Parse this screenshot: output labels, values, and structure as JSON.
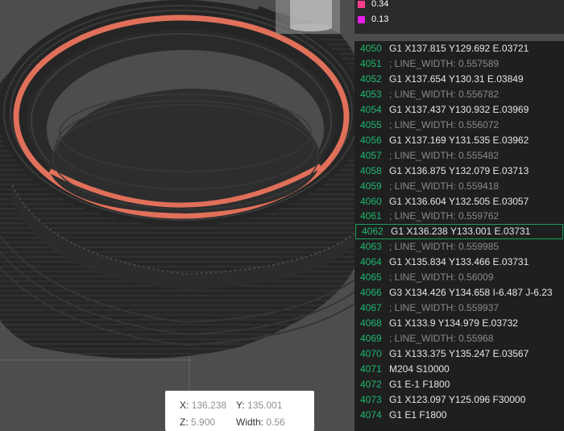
{
  "legend": {
    "items": [
      {
        "label": "0.34",
        "color": "#ff3d8b"
      },
      {
        "label": "0.13",
        "color": "#e61ee6"
      }
    ]
  },
  "gcode": {
    "lines": [
      {
        "num": "4050",
        "text": "G1 X137.815 Y129.692 E.03721",
        "comment": false
      },
      {
        "num": "4051",
        "text": "; LINE_WIDTH: 0.557589",
        "comment": true
      },
      {
        "num": "4052",
        "text": "G1 X137.654 Y130.31 E.03849",
        "comment": false
      },
      {
        "num": "4053",
        "text": "; LINE_WIDTH: 0.556782",
        "comment": true
      },
      {
        "num": "4054",
        "text": "G1 X137.437 Y130.932 E.03969",
        "comment": false
      },
      {
        "num": "4055",
        "text": "; LINE_WIDTH: 0.556072",
        "comment": true
      },
      {
        "num": "4056",
        "text": "G1 X137.169 Y131.535 E.03962",
        "comment": false
      },
      {
        "num": "4057",
        "text": "; LINE_WIDTH: 0.555482",
        "comment": true
      },
      {
        "num": "4058",
        "text": "G1 X136.875 Y132.079 E.03713",
        "comment": false
      },
      {
        "num": "4059",
        "text": "; LINE_WIDTH: 0.559418",
        "comment": true
      },
      {
        "num": "4060",
        "text": "G1 X136.604 Y132.505 E.03057",
        "comment": false
      },
      {
        "num": "4061",
        "text": "; LINE_WIDTH: 0.559762",
        "comment": true
      },
      {
        "num": "4062",
        "text": "G1 X136.238 Y133.001 E.03731",
        "comment": false,
        "selected": true
      },
      {
        "num": "4063",
        "text": "; LINE_WIDTH: 0.559985",
        "comment": true
      },
      {
        "num": "4064",
        "text": "G1 X135.834 Y133.466 E.03731",
        "comment": false
      },
      {
        "num": "4065",
        "text": "; LINE_WIDTH: 0.56009",
        "comment": true
      },
      {
        "num": "4066",
        "text": "G3 X134.426 Y134.658 I-6.487 J-6.23",
        "comment": false
      },
      {
        "num": "4067",
        "text": "; LINE_WIDTH: 0.559937",
        "comment": true
      },
      {
        "num": "4068",
        "text": "G1 X133.9 Y134.979 E.03732",
        "comment": false
      },
      {
        "num": "4069",
        "text": "; LINE_WIDTH: 0.55968",
        "comment": true
      },
      {
        "num": "4070",
        "text": "G1 X133.375 Y135.247 E.03567",
        "comment": false
      },
      {
        "num": "4071",
        "text": "M204 S10000",
        "comment": false
      },
      {
        "num": "4072",
        "text": "G1 E-1 F1800",
        "comment": false
      },
      {
        "num": "4073",
        "text": "G1 X123.097 Y125.096 F30000",
        "comment": false
      },
      {
        "num": "4074",
        "text": "G1 E1 F1800",
        "comment": false
      }
    ]
  },
  "tooltip": {
    "x_label": "X:",
    "x_value": "136.238",
    "y_label": "Y:",
    "y_value": "135.001",
    "z_label": "Z:",
    "z_value": "5.900",
    "width_label": "Width:",
    "width_value": "0.56"
  },
  "colors": {
    "toolpath_highlight": "#e0705a",
    "model": "#2b2b2b",
    "gcode_line_number": "#1db870"
  }
}
